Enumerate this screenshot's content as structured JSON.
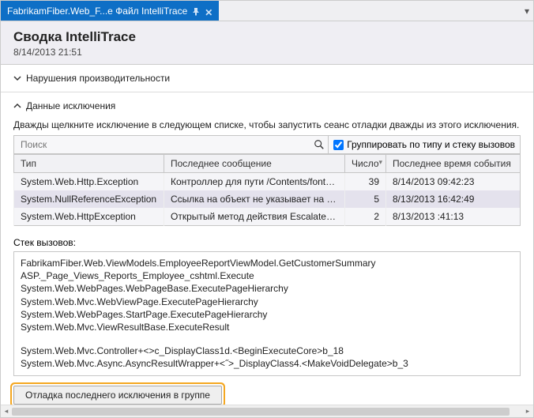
{
  "tab": {
    "label": "FabrikamFiber.Web_F...е Файл IntelliTrace"
  },
  "summary": {
    "title": "Сводка IntelliTrace",
    "timestamp": "8/14/2013 21:51"
  },
  "sections": {
    "perf_label": "Нарушения производительности",
    "exc_label": "Данные исключения"
  },
  "exc": {
    "instruction": "Дважды щелкните исключение в следующем списке, чтобы запустить сеанс отладки дважды из этого исключения.",
    "search_placeholder": "Поиск",
    "group_label": "Группировать по типу и стеку вызовов",
    "columns": {
      "type": "Тип",
      "msg": "Последнее сообщение",
      "count": "Число",
      "time": "Последнее время события"
    },
    "rows": [
      {
        "type": "System.Web.Http.Exception",
        "msg": "Контроллер для пути /Contents/fonts...",
        "count": "39",
        "time": "8/14/2013 09:42:23"
      },
      {
        "type": "System.NullReferenceException",
        "msg": "Ссылка на объект не указывает на экзе...",
        "count": "5",
        "time": "8/13/2013 16:42:49"
      },
      {
        "type": "System.Web.HttpException",
        "msg": "Открытый метод действия Escalate был...",
        "count": "2",
        "time": "8/13/2013 :41:13"
      }
    ],
    "callstack_label": "Стек вызовов:",
    "callstack1": [
      "FabrikamFiber.Web.ViewModels.EmployeeReportViewModel.GetCustomerSummary",
      "ASP._Page_Views_Reports_Employee_cshtml.Execute",
      "System.Web.WebPages.WebPageBase.ExecutePageHierarchy",
      "System.Web.Mvc.WebViewPage.ExecutePageHierarchy",
      "System.Web.WebPages.StartPage.ExecutePageHierarchy",
      "System.Web.Mvc.ViewResultBase.ExecuteResult"
    ],
    "callstack2": [
      "System.Web.Mvc.Controller+<>c_DisplayClass1d.<BeginExecuteCore>b_18",
      "System.Web.Mvc.Async.AsyncResultWrapper+<˝>_DisplayClass4.<MakeVoidDelegate>b_3"
    ],
    "debug_button": "Отладка последнего исключения в группе"
  }
}
